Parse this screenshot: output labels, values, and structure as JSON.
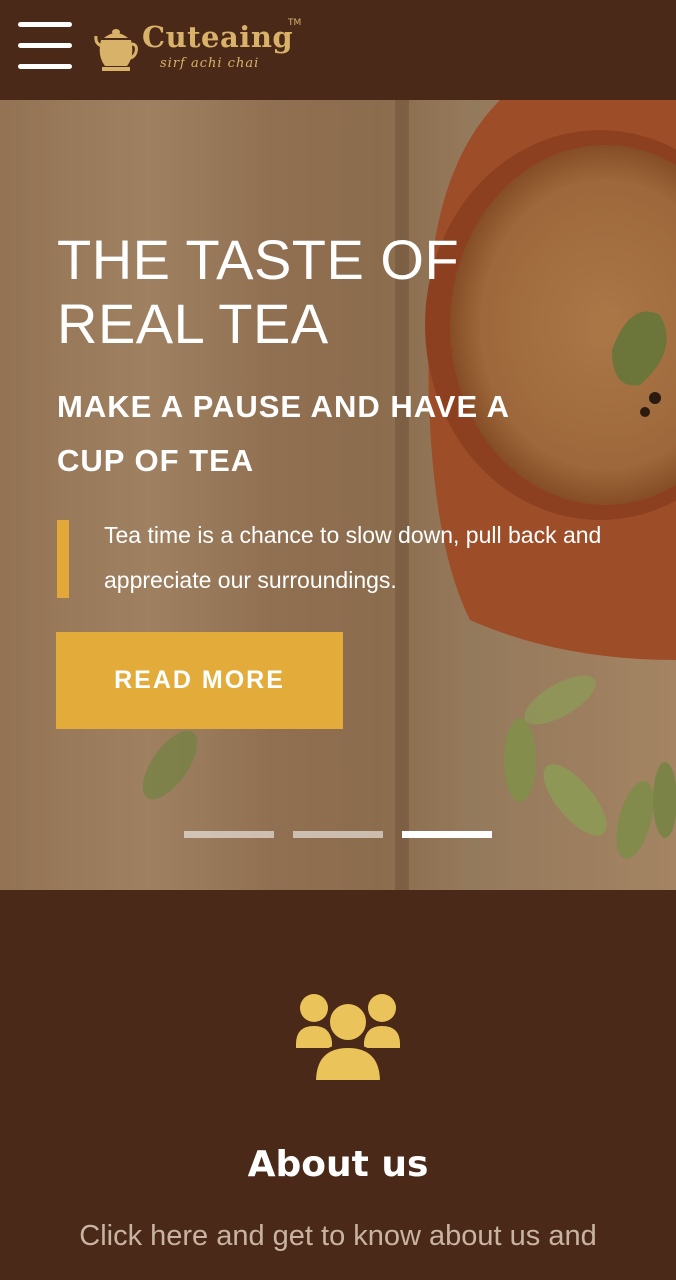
{
  "header": {
    "menu_icon": "hamburger-menu-icon",
    "logo": {
      "name": "Cuteaing",
      "trademark": "TM",
      "tagline": "sirf achi chai",
      "icon": "teapot-icon"
    }
  },
  "hero": {
    "title": "THE TASTE OF REAL TEA",
    "subtitle": "MAKE A PAUSE AND HAVE A CUP OF TEA",
    "quote": "Tea time is a chance to slow down, pull back and appreciate our surroundings.",
    "button_label": "READ MORE",
    "slides": {
      "count": 3,
      "active": 3
    }
  },
  "about": {
    "icon": "people-group-icon",
    "title": "About us",
    "text": "Click here and get to know about us and"
  },
  "colors": {
    "brown": "#4a2919",
    "accent": "#e3ac3a",
    "logo_gold": "#d9b26a",
    "icon_yellow": "#eac45a"
  }
}
